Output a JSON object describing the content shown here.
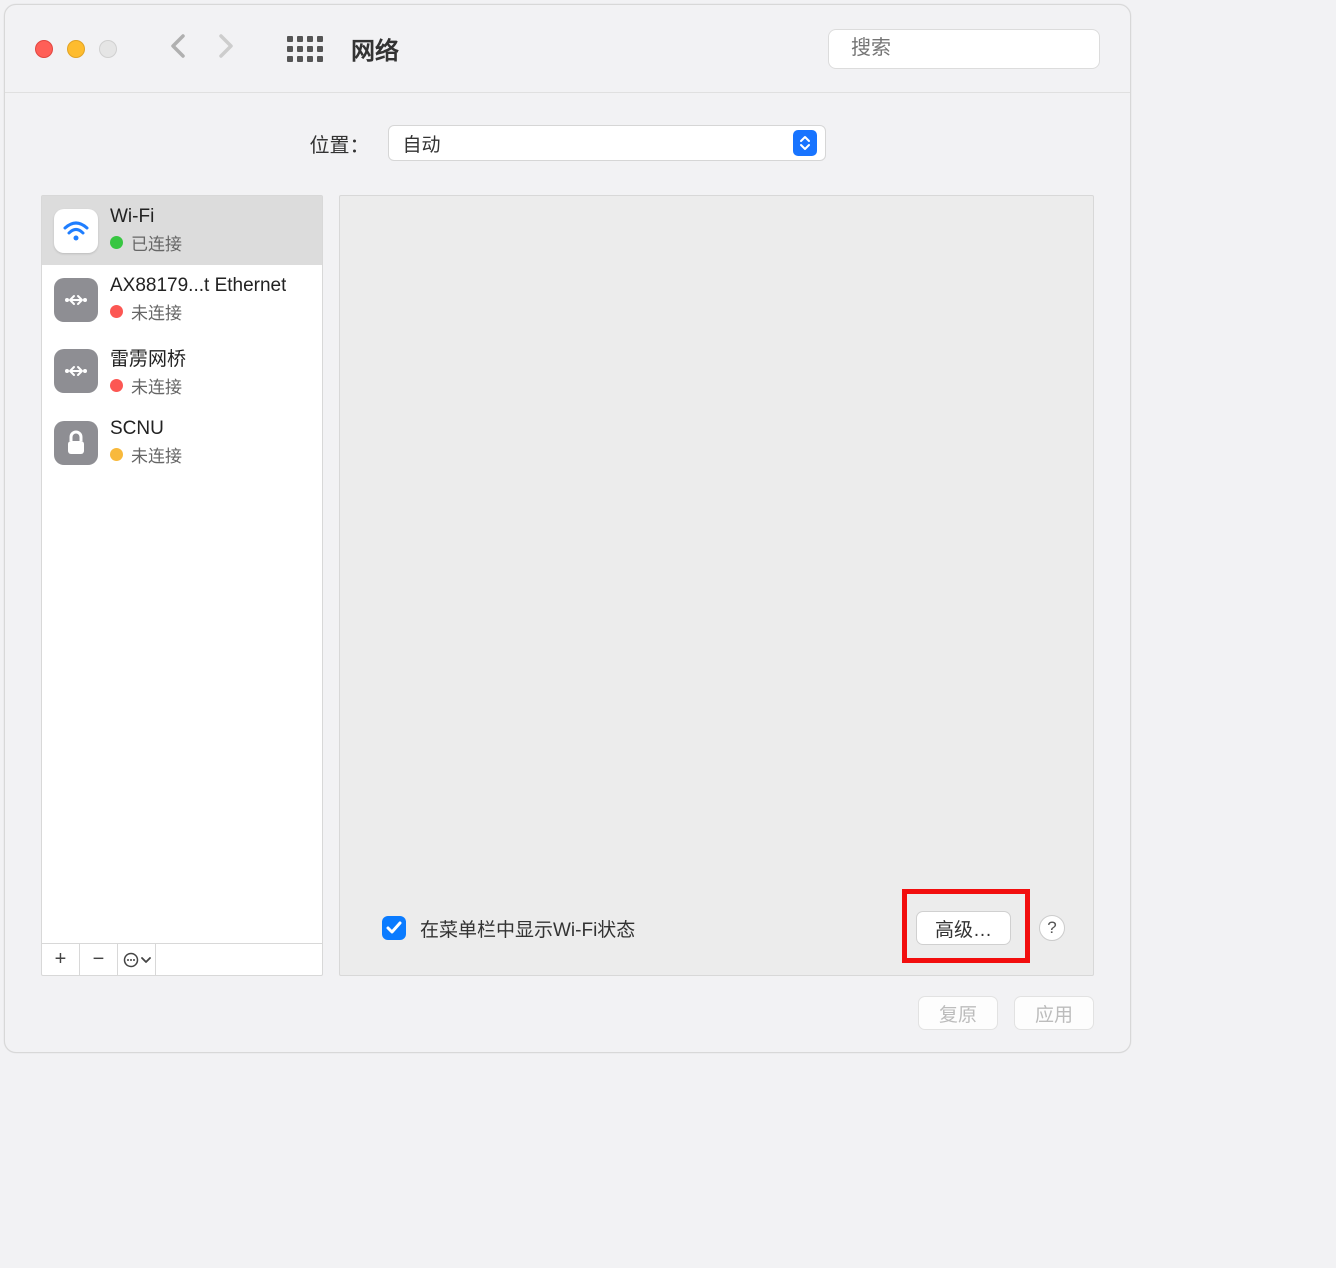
{
  "window": {
    "title": "网络"
  },
  "search": {
    "placeholder": "搜索"
  },
  "location": {
    "label": "位置：",
    "value": "自动"
  },
  "services": [
    {
      "name": "Wi-Fi",
      "status": "已连接",
      "status_color": "green",
      "icon_type": "wifi"
    },
    {
      "name": "AX88179...t Ethernet",
      "status": "未连接",
      "status_color": "red",
      "icon_type": "eth"
    },
    {
      "name": "雷雳网桥",
      "status": "未连接",
      "status_color": "red",
      "icon_type": "eth"
    },
    {
      "name": "SCNU",
      "status": "未连接",
      "status_color": "yellow",
      "icon_type": "lock"
    }
  ],
  "detail": {
    "show_in_menubar_label": "在菜单栏中显示Wi-Fi状态",
    "advanced_label": "高级…",
    "help_label": "?"
  },
  "footer": {
    "revert": "复原",
    "apply": "应用"
  },
  "highlight": {
    "target": "advanced-button"
  }
}
